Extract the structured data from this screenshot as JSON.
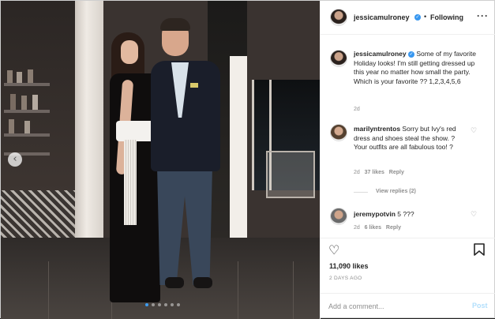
{
  "header": {
    "username": "jessicamulroney",
    "separator": "•",
    "follow_label": "Following",
    "more_label": "···"
  },
  "caption": {
    "username": "jessicamulroney",
    "text": "Some of my favorite Holiday looks! I'm still getting dressed up this year no matter how small the party. Which is your favorite ?? 1,2,3,4,5,6",
    "time": "2d"
  },
  "comments": [
    {
      "username": "marilyntrentos",
      "text": "Sorry but Ivy's red dress and shoes steal the show. ? Your outfits are all fabulous too! ?",
      "time": "2d",
      "likes": "37 likes",
      "reply_label": "Reply",
      "view_replies": "View replies (2)"
    },
    {
      "username": "jeremypotvin",
      "text": "5 ???",
      "time": "2d",
      "likes": "6 likes",
      "reply_label": "Reply"
    }
  ],
  "post": {
    "likes": "11,090 likes",
    "date": "2 DAYS AGO"
  },
  "add_comment": {
    "placeholder": "Add a comment...",
    "post_label": "Post"
  },
  "carousel": {
    "prev_icon": "chevron-left-icon",
    "dot_count": 6,
    "active_dot": 1
  },
  "colors": {
    "verified": "#3897f0",
    "post_disabled": "#b2dffc",
    "active_dot": "#3b9cf0"
  }
}
